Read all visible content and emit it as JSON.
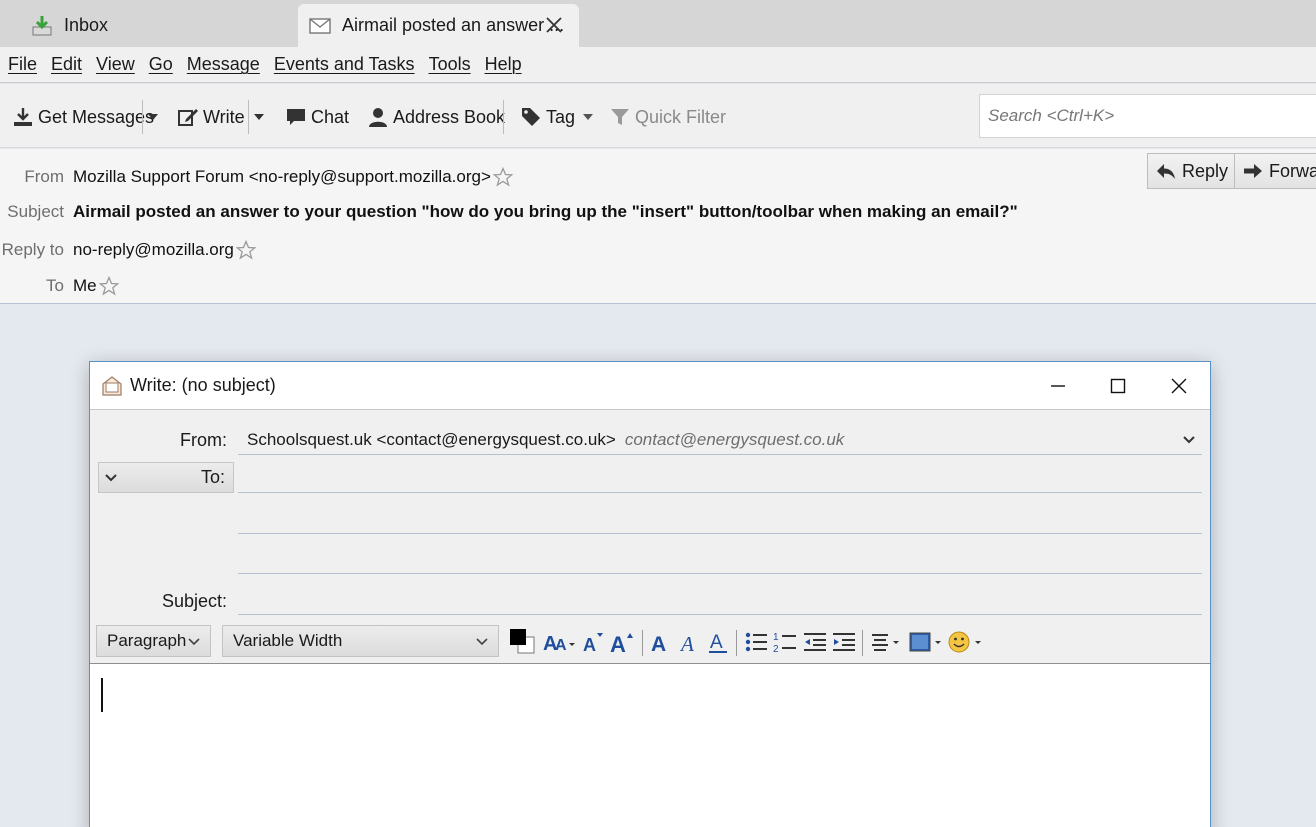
{
  "tabs": [
    {
      "label": "Inbox",
      "icon": "inbox-download-icon"
    },
    {
      "label": "Airmail posted an answer ...",
      "icon": "envelope-icon"
    }
  ],
  "menu": [
    "File",
    "Edit",
    "View",
    "Go",
    "Message",
    "Events and Tasks",
    "Tools",
    "Help"
  ],
  "toolbar": {
    "get_messages": "Get Messages",
    "write": "Write",
    "chat": "Chat",
    "address_book": "Address Book",
    "tag": "Tag",
    "quick_filter": "Quick Filter",
    "search_placeholder": "Search <Ctrl+K>"
  },
  "message": {
    "from_label": "From",
    "from_value": "Mozilla Support Forum <no-reply@support.mozilla.org>",
    "subject_label": "Subject",
    "subject_value": "Airmail posted an answer to your question \"how do you bring up the \"insert\" button/toolbar when making an email?\"",
    "reply_to_label": "Reply to",
    "reply_to_value": "no-reply@mozilla.org",
    "to_label": "To",
    "to_value": "Me",
    "reply_button": "Reply",
    "forward_button": "Forwar"
  },
  "compose": {
    "title": "Write: (no subject)",
    "from_label": "From:",
    "from_value": "Schoolsquest.uk <contact@energysquest.co.uk>",
    "from_hint": "contact@energysquest.co.uk",
    "to_label": "To:",
    "subject_label": "Subject:",
    "paragraph_select": "Paragraph",
    "font_select": "Variable Width"
  },
  "colors": {
    "accent_blue": "#1f4e9c",
    "window_border": "#5a91c9"
  }
}
